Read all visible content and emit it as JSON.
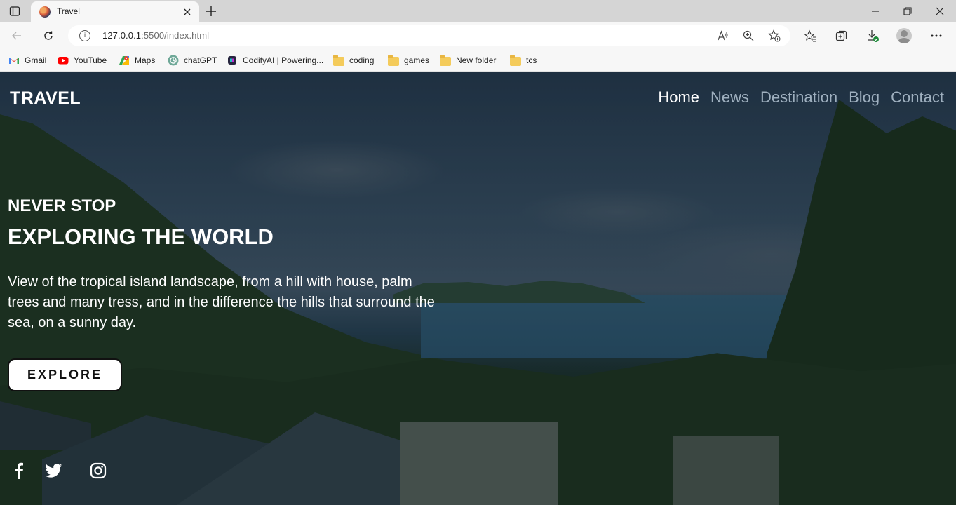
{
  "browser": {
    "tab": {
      "title": "Travel"
    },
    "address": {
      "host": "127.0.0.1",
      "rest": ":5500/index.html"
    },
    "bookmarks": [
      {
        "label": "Gmail",
        "icon": "gmail-icon"
      },
      {
        "label": "YouTube",
        "icon": "youtube-icon"
      },
      {
        "label": "Maps",
        "icon": "maps-icon"
      },
      {
        "label": "chatGPT",
        "icon": "chatgpt-icon"
      },
      {
        "label": "CodifyAI | Powering...",
        "icon": "codifyai-icon"
      },
      {
        "label": "coding",
        "icon": "folder-icon"
      },
      {
        "label": "games",
        "icon": "folder-icon"
      },
      {
        "label": "New folder",
        "icon": "folder-icon"
      },
      {
        "label": "tcs",
        "icon": "folder-icon"
      }
    ]
  },
  "site": {
    "logo": "TRAVEL",
    "nav": [
      {
        "label": "Home",
        "active": true
      },
      {
        "label": "News",
        "active": false
      },
      {
        "label": "Destination",
        "active": false
      },
      {
        "label": "Blog",
        "active": false
      },
      {
        "label": "Contact",
        "active": false
      }
    ],
    "hero": {
      "kicker": "NEVER STOP",
      "headline": "EXPLORING THE WORLD",
      "description": "View of the tropical island landscape, from a hill with house, palm trees and many tress, and in the difference the hills that surround the sea, on a sunny day.",
      "button": "EXPLORE"
    },
    "social": [
      "facebook-icon",
      "twitter-icon",
      "instagram-icon"
    ]
  },
  "colors": {
    "nav_inactive": "#9fb0bf",
    "nav_active": "#ffffff",
    "button_bg": "#ffffff"
  }
}
